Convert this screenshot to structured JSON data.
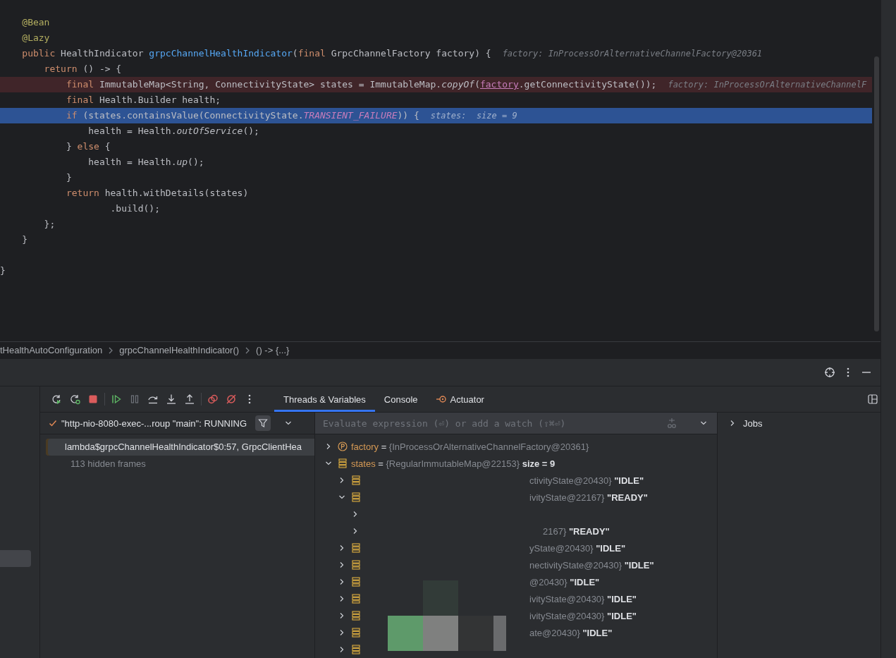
{
  "editor": {
    "lines": [
      {
        "kind": "code",
        "breakpoint": false,
        "current": false,
        "tokens": [
          {
            "text": "    @Bean",
            "kind": "annotation"
          }
        ]
      },
      {
        "kind": "code",
        "breakpoint": false,
        "current": false,
        "tokens": [
          {
            "text": "    @Lazy",
            "kind": "annotation"
          }
        ]
      },
      {
        "kind": "code",
        "breakpoint": false,
        "current": false,
        "tokens": [
          {
            "text": "    public",
            "kind": "keyword"
          },
          {
            "text": " HealthIndicator ",
            "kind": "plain"
          },
          {
            "text": "grpcChannelHealthIndicator",
            "kind": "function"
          },
          {
            "text": "(",
            "kind": "plain"
          },
          {
            "text": "final",
            "kind": "keyword"
          },
          {
            "text": " GrpcChannelFactory factory) {",
            "kind": "plain"
          }
        ],
        "hint": "factory: InProcessOrAlternativeChannelFactory@20361"
      },
      {
        "kind": "code",
        "breakpoint": false,
        "current": false,
        "tokens": [
          {
            "text": "        return",
            "kind": "keyword"
          },
          {
            "text": " () -> {",
            "kind": "plain"
          }
        ]
      },
      {
        "kind": "code",
        "breakpoint": true,
        "current": false,
        "tokens": [
          {
            "text": "            final",
            "kind": "keyword"
          },
          {
            "text": " ImmutableMap<String, ConnectivityState> states = ImmutableMap.",
            "kind": "plain"
          },
          {
            "text": "copyOf",
            "kind": "static"
          },
          {
            "text": "(",
            "kind": "plain"
          },
          {
            "text": "factory",
            "kind": "parameter"
          },
          {
            "text": ".getConnectivityState());",
            "kind": "plain"
          }
        ],
        "hint": "factory: InProcessOrAlternativeChannelF"
      },
      {
        "kind": "code",
        "breakpoint": false,
        "current": false,
        "tokens": [
          {
            "text": "            final",
            "kind": "keyword"
          },
          {
            "text": " Health.Builder health;",
            "kind": "plain"
          }
        ]
      },
      {
        "kind": "code",
        "breakpoint": false,
        "current": true,
        "tokens": [
          {
            "text": "            if",
            "kind": "keyword"
          },
          {
            "text": " (states.containsValue(ConnectivityState.",
            "kind": "plain"
          },
          {
            "text": "TRANSIENT_FAILURE",
            "kind": "constant"
          },
          {
            "text": ")) {",
            "kind": "plain"
          }
        ],
        "hint": "states:  size = 9"
      },
      {
        "kind": "code",
        "breakpoint": false,
        "current": false,
        "tokens": [
          {
            "text": "                health = Health.",
            "kind": "plain"
          },
          {
            "text": "outOfService",
            "kind": "static"
          },
          {
            "text": "();",
            "kind": "plain"
          }
        ]
      },
      {
        "kind": "code",
        "breakpoint": false,
        "current": false,
        "tokens": [
          {
            "text": "            } ",
            "kind": "plain"
          },
          {
            "text": "else",
            "kind": "keyword"
          },
          {
            "text": " {",
            "kind": "plain"
          }
        ]
      },
      {
        "kind": "code",
        "breakpoint": false,
        "current": false,
        "tokens": [
          {
            "text": "                health = Health.",
            "kind": "plain"
          },
          {
            "text": "up",
            "kind": "static"
          },
          {
            "text": "();",
            "kind": "plain"
          }
        ]
      },
      {
        "kind": "code",
        "breakpoint": false,
        "current": false,
        "tokens": [
          {
            "text": "            }",
            "kind": "plain"
          }
        ]
      },
      {
        "kind": "code",
        "breakpoint": false,
        "current": false,
        "tokens": [
          {
            "text": "            return",
            "kind": "keyword"
          },
          {
            "text": " health.withDetails(states)",
            "kind": "plain"
          }
        ]
      },
      {
        "kind": "code",
        "breakpoint": false,
        "current": false,
        "tokens": [
          {
            "text": "                    .build();",
            "kind": "plain"
          }
        ]
      },
      {
        "kind": "code",
        "breakpoint": false,
        "current": false,
        "tokens": [
          {
            "text": "        };",
            "kind": "plain"
          }
        ]
      },
      {
        "kind": "code",
        "breakpoint": false,
        "current": false,
        "tokens": [
          {
            "text": "    }",
            "kind": "plain"
          }
        ]
      },
      {
        "kind": "blank",
        "breakpoint": false,
        "current": false
      },
      {
        "kind": "code",
        "breakpoint": false,
        "current": false,
        "tokens": [
          {
            "text": "}",
            "kind": "plain"
          }
        ]
      }
    ]
  },
  "breadcrumbs": [
    "tHealthAutoConfiguration",
    "grpcChannelHealthIndicator()",
    "() -> {...}"
  ],
  "debugger": {
    "tabs": [
      {
        "label": "Threads & Variables",
        "selected": true,
        "kind": "plain"
      },
      {
        "label": "Console",
        "selected": false,
        "kind": "plain"
      },
      {
        "label": "Actuator",
        "selected": false,
        "kind": "plugin"
      }
    ],
    "thread": {
      "label": "\"http-nio-8080-exec-...roup \"main\": RUNNING",
      "filter_active": true
    },
    "frames": [
      {
        "label": "lambda$grpcChannelHealthIndicator$0:57, GrpcClientHea",
        "selected": true
      }
    ],
    "hidden_frames": "113 hidden frames",
    "evaluate": {
      "placeholder": "Evaluate expression (⏎) or add a watch (⇧⌘⏎)"
    },
    "variables": [
      {
        "kind": "parameter",
        "name": "factory",
        "op": "=",
        "value": "{InProcessOrAlternativeChannelFactory@20361}",
        "expanded": false
      },
      {
        "kind": "map",
        "name": "states",
        "op": "=",
        "value": "{RegularImmutableMap@22153}",
        "extra": "size = 9",
        "expanded": true,
        "children": [
          {
            "kind": "entry",
            "value": "ctivityState@20430}",
            "extra": "\"IDLE\"",
            "expanded": false
          },
          {
            "kind": "entry",
            "value": "ivityState@22167}",
            "extra": "\"READY\"",
            "expanded": true,
            "children": [
              {
                "expanded": false
              },
              {
                "value": "2167}",
                "extra": "\"READY\"",
                "expanded": false
              }
            ]
          },
          {
            "kind": "entry",
            "value": "yState@20430}",
            "extra": "\"IDLE\"",
            "expanded": false
          },
          {
            "kind": "entry",
            "value": "nectivityState@20430}",
            "extra": "\"IDLE\"",
            "expanded": false
          },
          {
            "kind": "entry",
            "value": "@20430}",
            "extra": "\"IDLE\"",
            "expanded": false
          },
          {
            "kind": "entry",
            "value": "ivityState@20430}",
            "extra": "\"IDLE\"",
            "expanded": false
          },
          {
            "kind": "entry",
            "value": "ivityState@20430}",
            "extra": "\"IDLE\"",
            "expanded": false
          },
          {
            "kind": "entry",
            "value": "ate@20430}",
            "extra": "\"IDLE\"",
            "expanded": false
          },
          {
            "kind": "entry",
            "expanded": false
          }
        ]
      }
    ],
    "jobs": {
      "label": "Jobs",
      "expanded": false
    }
  }
}
